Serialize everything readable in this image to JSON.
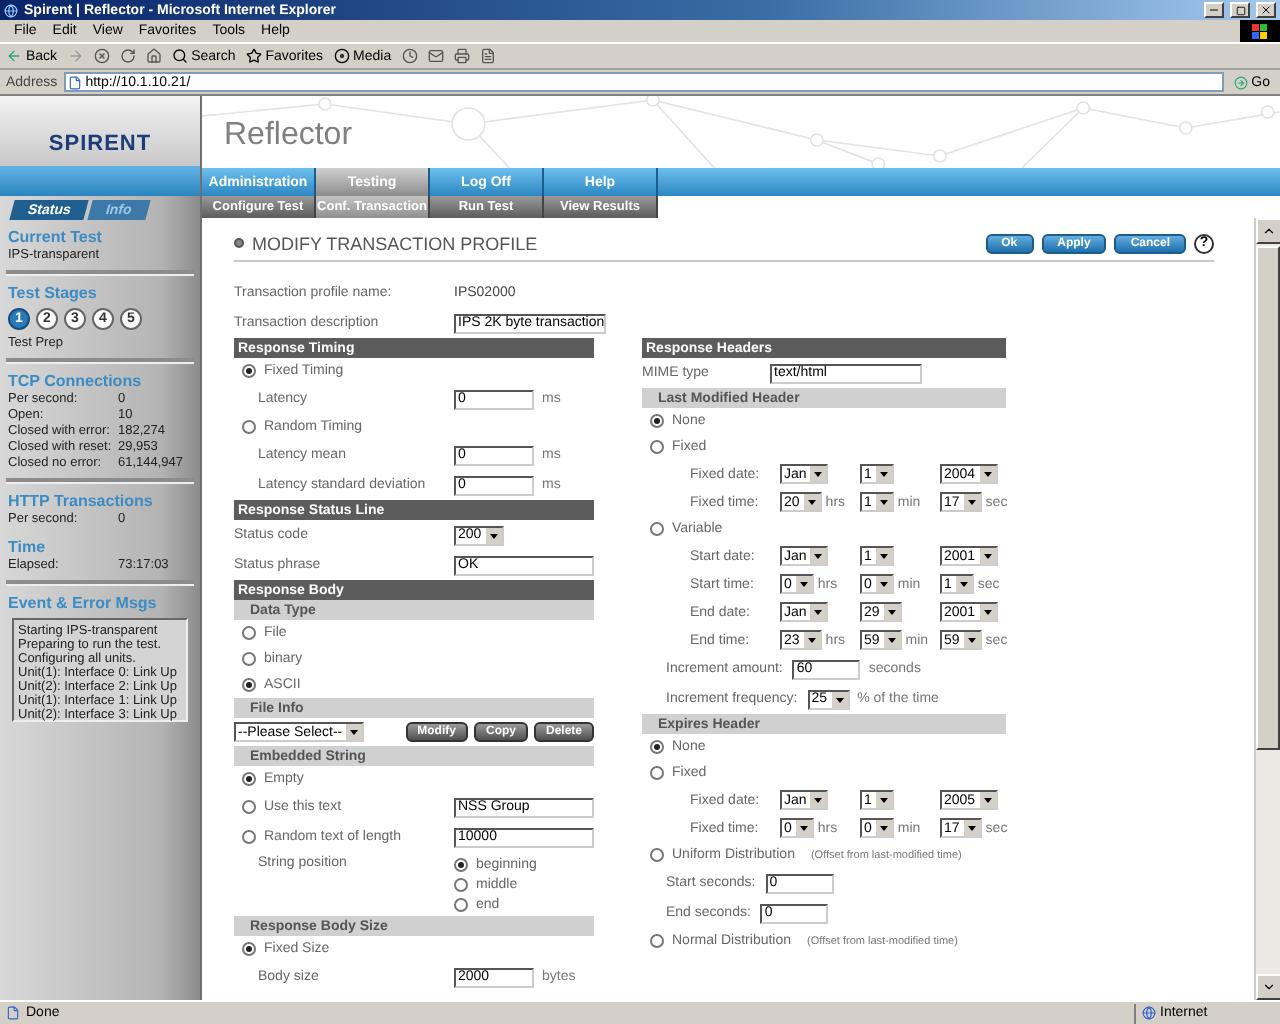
{
  "window": {
    "title": "Spirent | Reflector - Microsoft Internet Explorer"
  },
  "menu": [
    "File",
    "Edit",
    "View",
    "Favorites",
    "Tools",
    "Help"
  ],
  "toolbar": {
    "back": "Back",
    "search": "Search",
    "favorites": "Favorites",
    "media": "Media"
  },
  "address": {
    "label": "Address",
    "value": "http://10.1.10.21/",
    "go": "Go"
  },
  "sidebar": {
    "logo": "SPIRENT",
    "tabs": [
      {
        "label": "Status",
        "selected": true
      },
      {
        "label": "Info",
        "selected": false
      }
    ],
    "sections": [
      {
        "kind": "text",
        "title": "Current Test",
        "text": "IPS-transparent"
      },
      {
        "kind": "stages",
        "title": "Test Stages",
        "stages": [
          {
            "label": "1",
            "selected": true
          },
          {
            "label": "2",
            "selected": false
          },
          {
            "label": "3",
            "selected": false
          },
          {
            "label": "4",
            "selected": false
          },
          {
            "label": "5",
            "selected": false
          }
        ],
        "caption": "Test Prep"
      },
      {
        "kind": "stats",
        "title": "TCP Connections",
        "rows": [
          {
            "label": "Per second:",
            "value": "0"
          },
          {
            "label": "Open:",
            "value": "10"
          },
          {
            "label": "Closed with error:",
            "value": "182,274"
          },
          {
            "label": "Closed with reset:",
            "value": "29,953"
          },
          {
            "label": "Closed no error:",
            "value": "61,144,947"
          }
        ]
      },
      {
        "kind": "stats",
        "title": "HTTP Transactions",
        "rows": [
          {
            "label": "Per second:",
            "value": "0"
          }
        ]
      },
      {
        "kind": "stats",
        "title": "Time",
        "rows": [
          {
            "label": "Elapsed:",
            "value": "73:17:03"
          }
        ]
      },
      {
        "kind": "log",
        "title": "Event & Error Msgs",
        "lines": [
          "Starting IPS-transparent",
          "Preparing to run the test.",
          "Configuring all units.",
          "Unit(1): Interface 0: Link Up",
          "Unit(2): Interface 2: Link Up",
          "Unit(1): Interface 1: Link Up",
          "Unit(2): Interface 3: Link Up"
        ]
      }
    ]
  },
  "app": {
    "title": "Reflector",
    "nav": [
      {
        "label": "Administration",
        "selected": false
      },
      {
        "label": "Testing",
        "selected": true
      },
      {
        "label": "Log Off",
        "selected": false
      },
      {
        "label": "Help",
        "selected": false
      }
    ],
    "subnav": [
      {
        "label": "Configure Test",
        "selected": false
      },
      {
        "label": "Conf. Transaction",
        "selected": true
      },
      {
        "label": "Run Test",
        "selected": false
      },
      {
        "label": "View Results",
        "selected": false
      }
    ]
  },
  "page": {
    "title": "MODIFY TRANSACTION PROFILE",
    "buttons": [
      "Ok",
      "Apply",
      "Cancel"
    ],
    "help": "?"
  },
  "form": {
    "left": [
      {
        "kind": "static",
        "label": "Transaction profile name:",
        "value": "IPS02000"
      },
      {
        "kind": "text",
        "label": "Transaction description",
        "value": "IPS 2K byte transaction",
        "indented": false,
        "wide": true
      },
      {
        "kind": "header",
        "label": "Response Timing"
      },
      {
        "kind": "radio",
        "label": "Fixed Timing",
        "selected": true
      },
      {
        "kind": "text",
        "label": "Latency",
        "value": "0",
        "unit": "ms",
        "indented": true,
        "wide": false
      },
      {
        "kind": "radio",
        "label": "Random Timing",
        "selected": false
      },
      {
        "kind": "text",
        "label": "Latency mean",
        "value": "0",
        "unit": "ms",
        "indented": true,
        "wide": false
      },
      {
        "kind": "text",
        "label": "Latency standard deviation",
        "value": "0",
        "unit": "ms",
        "indented": true,
        "wide": false
      },
      {
        "kind": "header",
        "label": "Response Status Line"
      },
      {
        "kind": "select",
        "label": "Status code",
        "value": "200",
        "indented": false
      },
      {
        "kind": "text",
        "label": "Status phrase",
        "value": "OK",
        "indented": false,
        "wide": true
      },
      {
        "kind": "header",
        "label": "Response Body"
      },
      {
        "kind": "subheader",
        "label": "Data Type"
      },
      {
        "kind": "radio",
        "label": "File",
        "selected": false
      },
      {
        "kind": "radio",
        "label": "binary",
        "selected": false
      },
      {
        "kind": "radio",
        "label": "ASCII",
        "selected": true
      },
      {
        "kind": "subheader",
        "label": "File Info"
      },
      {
        "kind": "file-select",
        "value": "--Please Select--",
        "buttons": [
          "Modify",
          "Copy",
          "Delete"
        ]
      },
      {
        "kind": "subheader",
        "label": "Embedded String"
      },
      {
        "kind": "radio",
        "label": "Empty",
        "selected": true
      },
      {
        "kind": "radio-text",
        "label": "Use this text",
        "selected": false,
        "value": "NSS Group"
      },
      {
        "kind": "radio-text",
        "label": "Random text of length",
        "selected": false,
        "value": "10000"
      },
      {
        "kind": "choice",
        "label": "String position",
        "options": [
          {
            "label": "beginning",
            "selected": true
          },
          {
            "label": "middle",
            "selected": false
          },
          {
            "label": "end",
            "selected": false
          }
        ]
      },
      {
        "kind": "subheader",
        "label": "Response Body Size"
      },
      {
        "kind": "radio",
        "label": "Fixed Size",
        "selected": true
      },
      {
        "kind": "text",
        "label": "Body size",
        "value": "2000",
        "unit": "bytes",
        "indented": true,
        "wide": false
      }
    ],
    "right": [
      {
        "kind": "header",
        "label": "Response Headers"
      },
      {
        "kind": "text",
        "label": "MIME type",
        "value": "text/html",
        "indented": false,
        "wide": true
      },
      {
        "kind": "subheader",
        "label": "Last Modified Header"
      },
      {
        "kind": "radio",
        "label": "None",
        "selected": true
      },
      {
        "kind": "radio",
        "label": "Fixed",
        "selected": false
      },
      {
        "kind": "datetime",
        "label": "Fixed date:",
        "parts": [
          {
            "value": "Jan"
          },
          {
            "value": "1"
          },
          {
            "value": "2004"
          }
        ]
      },
      {
        "kind": "datetime",
        "label": "Fixed time:",
        "parts": [
          {
            "value": "20",
            "unit": "hrs"
          },
          {
            "value": "1",
            "unit": "min"
          },
          {
            "value": "17",
            "unit": "sec"
          }
        ]
      },
      {
        "kind": "radio",
        "label": "Variable",
        "selected": false
      },
      {
        "kind": "datetime",
        "label": "Start date:",
        "parts": [
          {
            "value": "Jan"
          },
          {
            "value": "1"
          },
          {
            "value": "2001"
          }
        ]
      },
      {
        "kind": "datetime",
        "label": "Start time:",
        "parts": [
          {
            "value": "0",
            "unit": "hrs"
          },
          {
            "value": "0",
            "unit": "min"
          },
          {
            "value": "1",
            "unit": "sec"
          }
        ]
      },
      {
        "kind": "datetime",
        "label": "End date:",
        "parts": [
          {
            "value": "Jan"
          },
          {
            "value": "29"
          },
          {
            "value": "2001"
          }
        ]
      },
      {
        "kind": "datetime",
        "label": "End time:",
        "parts": [
          {
            "value": "23",
            "unit": "hrs"
          },
          {
            "value": "59",
            "unit": "min"
          },
          {
            "value": "59",
            "unit": "sec"
          }
        ]
      },
      {
        "kind": "text",
        "label": "Increment amount:",
        "value": "60",
        "unit": "seconds",
        "indented": true,
        "wide": false
      },
      {
        "kind": "select",
        "label": "Increment frequency:",
        "value": "25",
        "unit": "% of the time",
        "indented": true
      },
      {
        "kind": "subheader",
        "label": "Expires Header"
      },
      {
        "kind": "radio",
        "label": "None",
        "selected": true
      },
      {
        "kind": "radio",
        "label": "Fixed",
        "selected": false
      },
      {
        "kind": "datetime",
        "label": "Fixed date:",
        "parts": [
          {
            "value": "Jan"
          },
          {
            "value": "1"
          },
          {
            "value": "2005"
          }
        ]
      },
      {
        "kind": "datetime",
        "label": "Fixed time:",
        "parts": [
          {
            "value": "0",
            "unit": "hrs"
          },
          {
            "value": "0",
            "unit": "min"
          },
          {
            "value": "17",
            "unit": "sec"
          }
        ]
      },
      {
        "kind": "radio",
        "label": "Uniform Distribution",
        "note": "(Offset from last-modified time)",
        "selected": false
      },
      {
        "kind": "text",
        "label": "Start seconds:",
        "value": "0",
        "indented": true,
        "wide": false
      },
      {
        "kind": "text",
        "label": "End seconds:",
        "value": "0",
        "indented": true,
        "wide": false
      },
      {
        "kind": "radio",
        "label": "Normal Distribution",
        "note": "(Offset from last-modified time)",
        "selected": false
      }
    ]
  },
  "status_bar": {
    "text": "Done",
    "zone": "Internet"
  }
}
